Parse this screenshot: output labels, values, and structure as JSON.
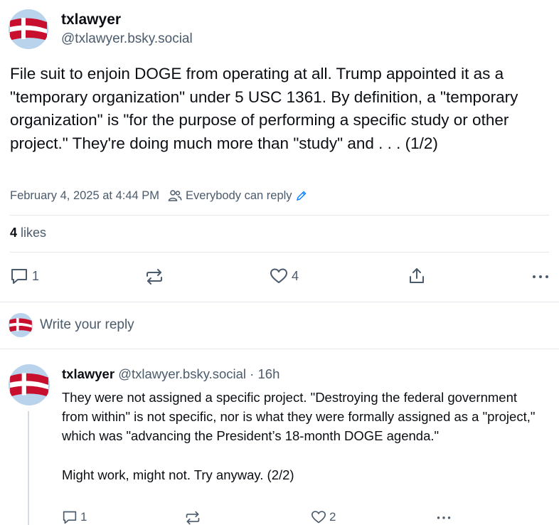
{
  "post": {
    "author_name": "txlawyer",
    "author_handle": "@txlawyer.bsky.social",
    "text": "File suit to enjoin DOGE from operating at all. Trump appointed it as a \"temporary organization\" under 5 USC 1361. By definition, a \"temporary organization\" is \"for the purpose of performing a specific study or other project.\" They're doing much more than \"study\" and . . . (1/2)",
    "timestamp": "February 4, 2025 at 4:44 PM",
    "reply_setting": "Everybody can reply",
    "likes_count": "4",
    "likes_label": " likes",
    "actions": {
      "reply_count": "1",
      "repost_count": "",
      "like_count": "4"
    }
  },
  "compose": {
    "placeholder": "Write your reply"
  },
  "reply": {
    "author_name": "txlawyer",
    "author_handle": "@txlawyer.bsky.social",
    "separator": " · ",
    "age": "16h",
    "text": "They were not assigned a specific project. \"Destroying the federal government from within\" is not specific, nor is what they were formally assigned as a \"project,\" which was \"advancing the President’s 18-month DOGE agenda.\"\n\nMight work, might not. Try anyway. (2/2)",
    "actions": {
      "reply_count": "1",
      "like_count": "2"
    }
  },
  "colors": {
    "muted": "#4b5b6c",
    "accent": "#1083fe",
    "divider": "#e4e8ec",
    "flag_red": "#c8102e"
  },
  "icons": [
    "reply-icon",
    "repost-icon",
    "like-icon",
    "share-icon",
    "more-icon",
    "people-icon",
    "pencil-icon"
  ]
}
